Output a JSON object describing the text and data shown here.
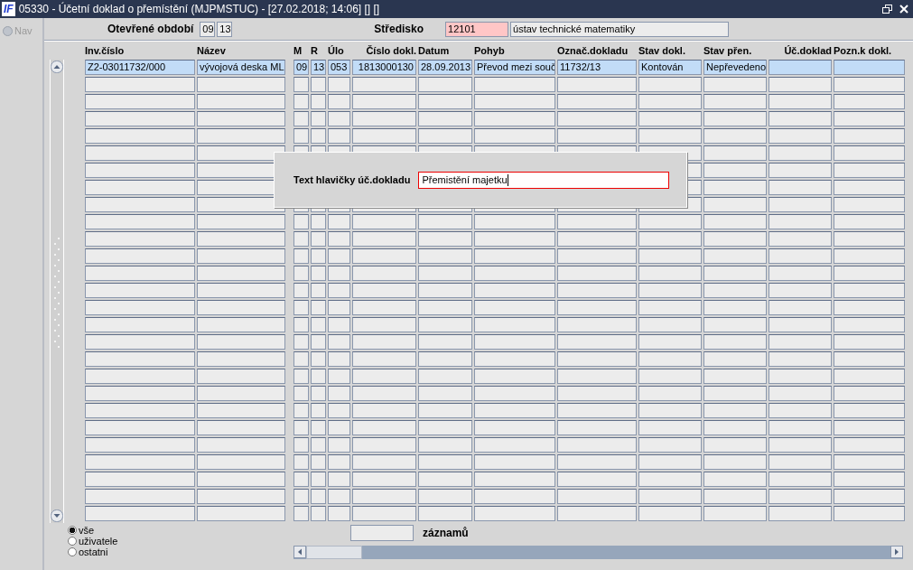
{
  "window": {
    "logo": "IF",
    "title": "05330 - Účetní doklad o přemístění (MJPMSTUC) - [27.02.2018; 14:06] [] []"
  },
  "nav": {
    "label": "Nav",
    "disabled": true
  },
  "period": {
    "label": "Otevřené období",
    "month": "09",
    "year": "13"
  },
  "center": {
    "label": "Středisko",
    "code": "12101",
    "name": "ústav technické matematiky"
  },
  "table": {
    "columns": [
      "Inv.číslo",
      "Název",
      "M",
      "R",
      "Úlo",
      "Číslo dokl.",
      "Datum",
      "Pohyb",
      "Označ.dokladu",
      "Stav dokl.",
      "Stav přen.",
      "Úč.doklad",
      "Pozn.k dokl."
    ],
    "rows": [
      {
        "selected": true,
        "cells": [
          "Z2-03011732/000",
          "vývojová deska ML",
          "09",
          "13",
          "053",
          "1813000130",
          "28.09.2013",
          "Převod mezi souč",
          "11732/13",
          "Kontován",
          "Nepřevedeno",
          "",
          ""
        ]
      },
      {
        "selected": false
      },
      {
        "selected": false
      },
      {
        "selected": false
      },
      {
        "selected": false
      },
      {
        "selected": false
      },
      {
        "selected": false
      },
      {
        "selected": false
      },
      {
        "selected": false
      },
      {
        "selected": false
      },
      {
        "selected": false
      },
      {
        "selected": false
      },
      {
        "selected": false
      },
      {
        "selected": false
      },
      {
        "selected": false
      },
      {
        "selected": false
      },
      {
        "selected": false
      },
      {
        "selected": false
      },
      {
        "selected": false
      },
      {
        "selected": false
      },
      {
        "selected": false
      },
      {
        "selected": false
      },
      {
        "selected": false
      },
      {
        "selected": false
      },
      {
        "selected": false
      },
      {
        "selected": false
      },
      {
        "selected": false
      }
    ]
  },
  "filter": [
    {
      "label": "vše",
      "selected": true
    },
    {
      "label": "uživatele",
      "selected": false
    },
    {
      "label": "ostatni",
      "selected": false
    }
  ],
  "count": {
    "label": "záznamů"
  },
  "dialog": {
    "label": "Text hlavičky úč.dokladu",
    "value": "Přemistění majetku"
  }
}
